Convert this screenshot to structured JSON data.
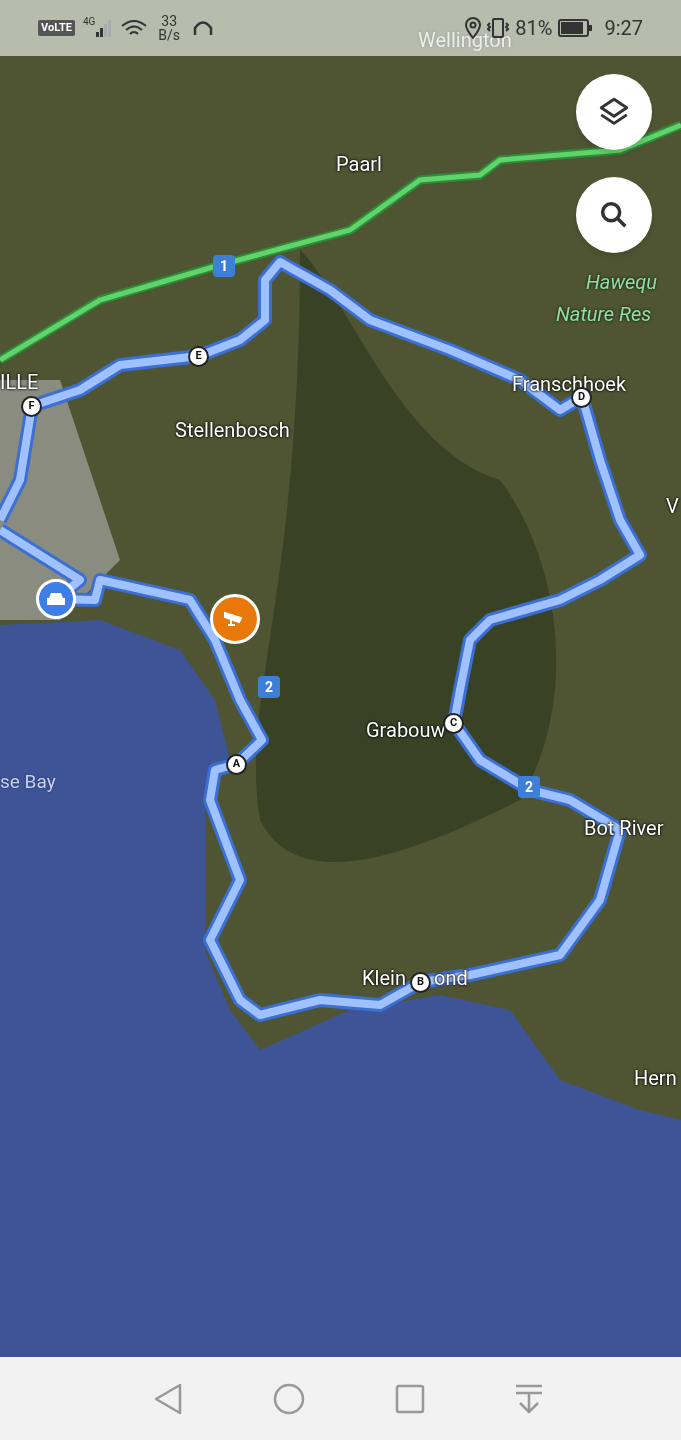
{
  "status_bar": {
    "volte": "VoLTE",
    "network": "4G",
    "speed_value": "33",
    "speed_unit": "B/s",
    "battery": "81%",
    "time": "9:27"
  },
  "map": {
    "places": [
      {
        "label": "Wellington",
        "kind": "town"
      },
      {
        "label": "Paarl",
        "kind": "town"
      },
      {
        "label": "Hawequ",
        "kind": "park"
      },
      {
        "label": "Nature Res",
        "kind": "park"
      },
      {
        "label": "ILLE",
        "kind": "town"
      },
      {
        "label": "Stellenbosch",
        "kind": "town"
      },
      {
        "label": "Franschhoek",
        "kind": "town"
      },
      {
        "label": "V",
        "kind": "town"
      },
      {
        "label": "se Bay",
        "kind": "water"
      },
      {
        "label": "Grabouw",
        "kind": "town"
      },
      {
        "label": "Bot River",
        "kind": "town"
      },
      {
        "label": "Klein",
        "kind": "town"
      },
      {
        "label": "ond",
        "kind": "town"
      },
      {
        "label": "Hern",
        "kind": "town"
      }
    ],
    "road_shields": [
      "1",
      "2",
      "2"
    ],
    "waypoints": [
      "E",
      "F",
      "D",
      "C",
      "A",
      "B"
    ]
  }
}
